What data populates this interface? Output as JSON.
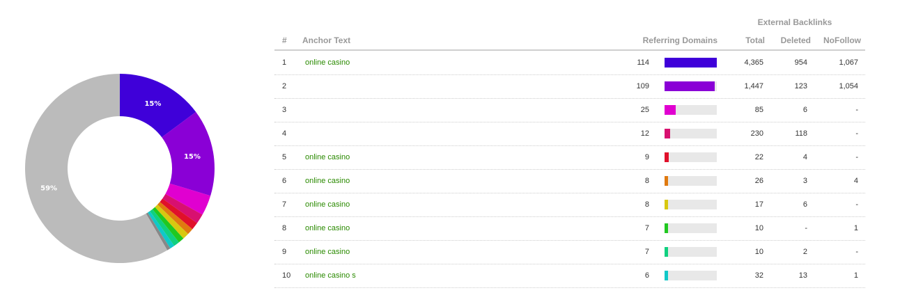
{
  "chart_data": [
    {
      "type": "pie",
      "hole": true,
      "slices": [
        {
          "value": 15,
          "color": "#3f00d9"
        },
        {
          "value": 15,
          "color": "#8a00d6"
        },
        {
          "value": 3.5,
          "color": "#e000d0"
        },
        {
          "value": 1.7,
          "color": "#d81070"
        },
        {
          "value": 1.3,
          "color": "#e0102a"
        },
        {
          "value": 1.1,
          "color": "#e07a10"
        },
        {
          "value": 1.1,
          "color": "#d8c810"
        },
        {
          "value": 1.0,
          "color": "#20c820"
        },
        {
          "value": 1.0,
          "color": "#10d080"
        },
        {
          "value": 0.8,
          "color": "#10c8c8"
        },
        {
          "value": 0.6,
          "color": "#888888"
        },
        {
          "value": 59,
          "color": "#bbbbbb"
        }
      ],
      "labels": [
        {
          "slice": 0,
          "text": "15%"
        },
        {
          "slice": 1,
          "text": "15%"
        },
        {
          "slice": 11,
          "text": "59%"
        }
      ]
    },
    {
      "type": "table",
      "group_header": "External Backlinks",
      "columns": [
        "#",
        "Anchor Text",
        "Referring Domains",
        "Total",
        "Deleted",
        "NoFollow"
      ],
      "rows": [
        {
          "idx": "1",
          "anchor": "online casino",
          "rd": 114,
          "total": "4,365",
          "deleted": "954",
          "nofollow": "1,067",
          "color": "#3f00d9"
        },
        {
          "idx": "2",
          "anchor": "",
          "rd": 109,
          "total": "1,447",
          "deleted": "123",
          "nofollow": "1,054",
          "color": "#8a00d6"
        },
        {
          "idx": "3",
          "anchor": "",
          "rd": 25,
          "total": "85",
          "deleted": "6",
          "nofollow": "-",
          "color": "#e000d0"
        },
        {
          "idx": "4",
          "anchor": "",
          "rd": 12,
          "total": "230",
          "deleted": "118",
          "nofollow": "-",
          "color": "#d81070"
        },
        {
          "idx": "5",
          "anchor": "online casino",
          "rd": 9,
          "total": "22",
          "deleted": "4",
          "nofollow": "-",
          "color": "#e0102a"
        },
        {
          "idx": "6",
          "anchor": "online casino",
          "rd": 8,
          "total": "26",
          "deleted": "3",
          "nofollow": "4",
          "color": "#e07a10"
        },
        {
          "idx": "7",
          "anchor": "online casino",
          "rd": 8,
          "total": "17",
          "deleted": "6",
          "nofollow": "-",
          "color": "#d8c810"
        },
        {
          "idx": "8",
          "anchor": "online casino",
          "rd": 7,
          "total": "10",
          "deleted": "-",
          "nofollow": "1",
          "color": "#20c820"
        },
        {
          "idx": "9",
          "anchor": "online casino",
          "rd": 7,
          "total": "10",
          "deleted": "2",
          "nofollow": "-",
          "color": "#10d080"
        },
        {
          "idx": "10",
          "anchor": "online casino s",
          "rd": 6,
          "total": "32",
          "deleted": "13",
          "nofollow": "1",
          "color": "#10c8c8"
        }
      ],
      "bar_max": 114
    }
  ]
}
